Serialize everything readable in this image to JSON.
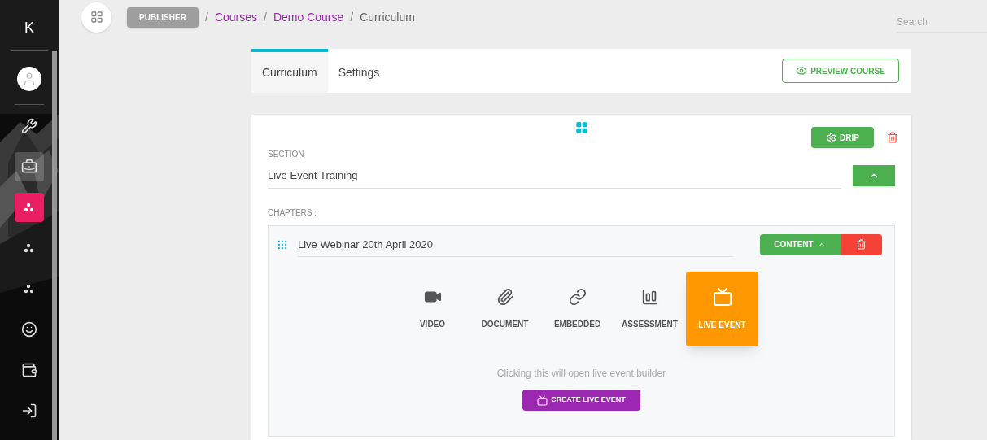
{
  "sidebar": {
    "logo": "K",
    "items": [
      {
        "selected": false,
        "highlighted": false
      },
      {
        "selected": false,
        "highlighted": true
      },
      {
        "selected": true,
        "highlighted": false
      },
      {
        "selected": false,
        "highlighted": false
      },
      {
        "selected": false,
        "highlighted": false
      },
      {
        "selected": false,
        "highlighted": false
      },
      {
        "selected": false,
        "highlighted": false
      },
      {
        "selected": false,
        "highlighted": false
      }
    ]
  },
  "topbar": {
    "role": "PUBLISHER",
    "breadcrumbs": [
      {
        "separator": "/",
        "label": "Courses",
        "link": true
      },
      {
        "separator": "/",
        "label": "Demo Course",
        "link": true
      },
      {
        "separator": "/",
        "label": "Curriculum",
        "link": false
      }
    ],
    "search": {
      "placeholder": "Search"
    }
  },
  "tabs": [
    {
      "label": "Curriculum",
      "selected": true
    },
    {
      "label": "Settings",
      "selected": false
    }
  ],
  "preview_button": "PREVIEW COURSE",
  "section": {
    "drip_button": "DRIP",
    "label": "SECTION",
    "value": "Live Event Training",
    "chapters_label": "CHAPTERS :",
    "chapter": {
      "title": "Live Webinar 20th April 2020",
      "content_button": "CONTENT",
      "content_types": [
        {
          "label": "VIDEO",
          "selected": false
        },
        {
          "label": "DOCUMENT",
          "selected": false
        },
        {
          "label": "EMBEDDED",
          "selected": false
        },
        {
          "label": "ASSESSMENT",
          "selected": false
        },
        {
          "label": "LIVE EVENT",
          "selected": true
        }
      ],
      "hint": "Clicking this will open live event builder",
      "create_button": "CREATE LIVE EVENT"
    }
  }
}
